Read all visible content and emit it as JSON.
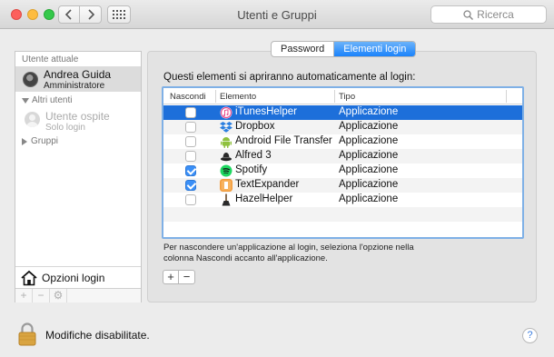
{
  "window": {
    "title": "Utenti e Gruppi"
  },
  "toolbar": {
    "back_icon": "chevron-left-icon",
    "forward_icon": "chevron-right-icon",
    "grid_icon": "grid-icon",
    "search_placeholder": "Ricerca"
  },
  "sidebar": {
    "current_user_header": "Utente attuale",
    "current_user": {
      "name": "Andrea Guida",
      "role": "Amministratore"
    },
    "other_users_header": "Altri utenti",
    "guest": {
      "name": "Utente ospite",
      "role": "Solo login"
    },
    "groups_label": "Gruppi",
    "login_options_label": "Opzioni login",
    "footer_buttons": [
      "+",
      "−",
      "⚙"
    ]
  },
  "tabs": [
    {
      "label": "Password",
      "active": false
    },
    {
      "label": "Elementi login",
      "active": true
    }
  ],
  "main": {
    "intro": "Questi elementi si apriranno automaticamente al login:",
    "columns": [
      "Nascondi",
      "Elemento",
      "Tipo"
    ],
    "rows": [
      {
        "name": "iTunesHelper",
        "type": "Applicazione",
        "hidden": false,
        "selected": true,
        "icon": "itunes-icon"
      },
      {
        "name": "Dropbox",
        "type": "Applicazione",
        "hidden": false,
        "selected": false,
        "icon": "dropbox-icon"
      },
      {
        "name": "Android File Transfer",
        "type": "Applicazione",
        "hidden": false,
        "selected": false,
        "icon": "android-icon"
      },
      {
        "name": "Alfred 3",
        "type": "Applicazione",
        "hidden": false,
        "selected": false,
        "icon": "alfred-icon"
      },
      {
        "name": "Spotify",
        "type": "Applicazione",
        "hidden": true,
        "selected": false,
        "icon": "spotify-icon"
      },
      {
        "name": "TextExpander",
        "type": "Applicazione",
        "hidden": true,
        "selected": false,
        "icon": "textexpander-icon"
      },
      {
        "name": "HazelHelper",
        "type": "Applicazione",
        "hidden": false,
        "selected": false,
        "icon": "hazel-icon"
      }
    ],
    "help_text": "Per nascondere un'applicazione al login, seleziona l'opzione nella colonna Nascondi accanto all'applicazione.",
    "add_label": "+",
    "remove_label": "−"
  },
  "bottom": {
    "lock_label": "Modifiche disabilitate.",
    "help_label": "?"
  },
  "colors": {
    "selection": "#1d6fda",
    "segment_active": "#1a82fb",
    "checkbox_checked": "#3a8ff7"
  }
}
